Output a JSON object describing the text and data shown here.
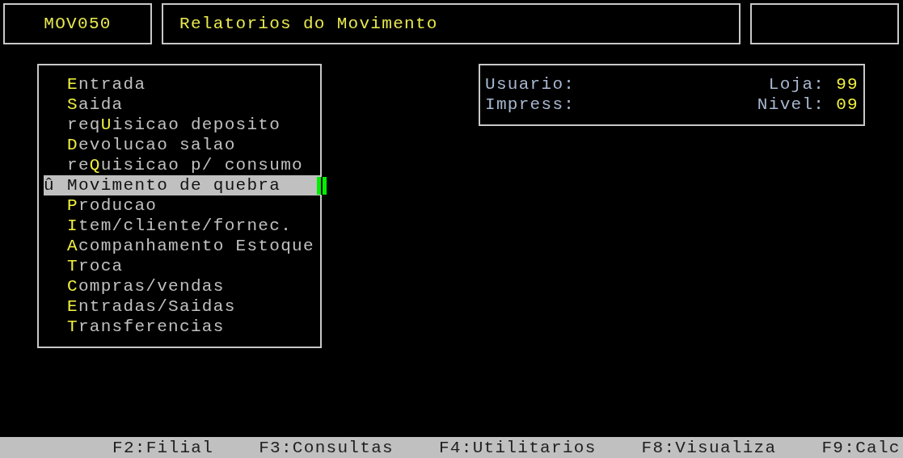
{
  "header": {
    "code": "MOV050",
    "title": "Relatorios do Movimento"
  },
  "menu": {
    "items": [
      {
        "hotkey": "E",
        "after": "ntrada",
        "selected": false
      },
      {
        "hotkey": "S",
        "after": "aida",
        "selected": false
      },
      {
        "before": "req",
        "hotkey": "U",
        "after": "isicao deposito",
        "selected": false
      },
      {
        "hotkey": "D",
        "after": "evolucao salao",
        "selected": false
      },
      {
        "before": "re",
        "hotkey": "Q",
        "after": "uisicao p/ consumo",
        "selected": false
      },
      {
        "marker": "û",
        "before": "Movimento de quebra",
        "selected": true
      },
      {
        "hotkey": "P",
        "after": "roducao",
        "selected": false
      },
      {
        "hotkey": "I",
        "after": "tem/cliente/fornec.",
        "selected": false
      },
      {
        "hotkey": "A",
        "after": "companhamento Estoque",
        "selected": false
      },
      {
        "hotkey": "T",
        "after": "roca",
        "selected": false
      },
      {
        "hotkey": "C",
        "after": "ompras/vendas",
        "selected": false
      },
      {
        "hotkey": "E",
        "after": "ntradas/Saidas",
        "selected": false
      },
      {
        "hotkey": "T",
        "after": "ransferencias",
        "selected": false
      }
    ]
  },
  "info": {
    "rows": [
      {
        "label": "Usuario:",
        "field_label": "Loja:",
        "value": "99"
      },
      {
        "label": "Impress:",
        "field_label": "Nivel:",
        "value": "09"
      }
    ]
  },
  "function_keys": [
    "F2:Filial",
    "F3:Consultas",
    "F4:Utilitarios",
    "F8:Visualiza",
    "F9:Calc"
  ]
}
